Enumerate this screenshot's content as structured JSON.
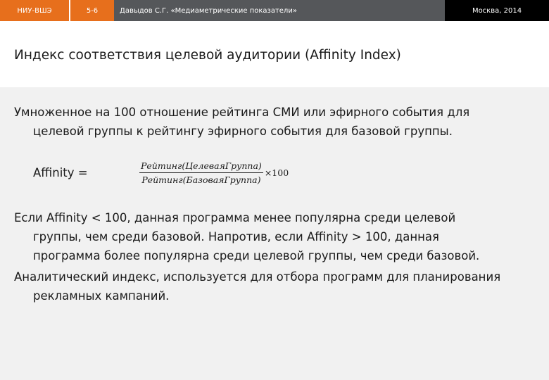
{
  "header": {
    "org": "НИУ-ВШЭ",
    "pages": "5-6",
    "author": "Давыдов С.Г. «Медиаметрические показатели»",
    "city_year": "Москва, 2014"
  },
  "title": "Индекс соответствия целевой аудитории (Affinity Index)",
  "definition": {
    "line1": "Умноженное на 100 отношение рейтинга СМИ или эфирного события для",
    "line2": "целевой группы к рейтингу эфирного события для базовой группы."
  },
  "formula": {
    "label": "Affinity =",
    "numerator": "Рейтинг(ЦелеваяГруппа)",
    "denominator": "Рейтинг(БазоваяГруппа)",
    "multiplier": "×100"
  },
  "comparison": {
    "line1": "Если Affinity < 100, данная программа менее популярна среди целевой",
    "line2": "группы, чем среди базовой. Напротив, если Affinity > 100, данная",
    "line3": "программа более популярна среди целевой группы, чем среди базовой."
  },
  "analytic": {
    "line1": "Аналитический индекс, используется для отбора программ для планирования",
    "line2": "рекламных кампаний."
  },
  "colors": {
    "accent": "#e76f1c",
    "bar": "#55575a",
    "content_bg": "#f1f1f1"
  }
}
